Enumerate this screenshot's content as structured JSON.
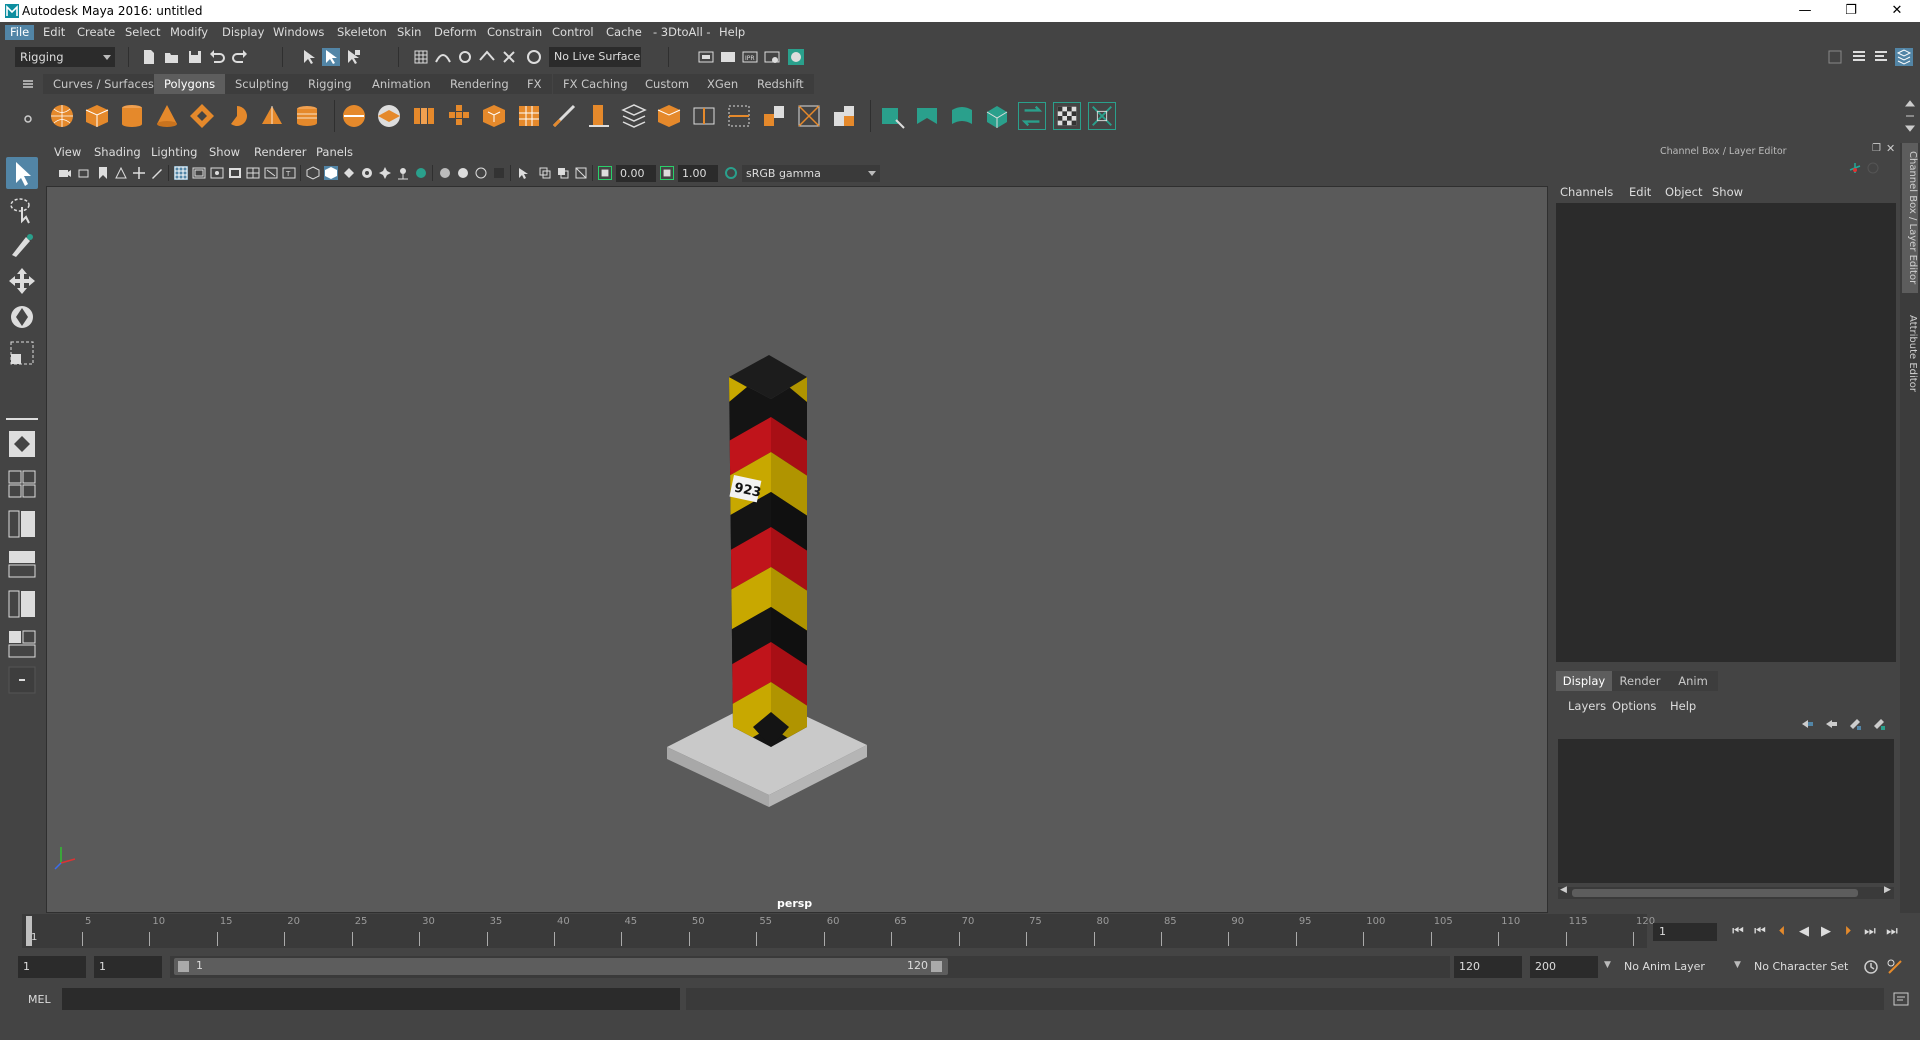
{
  "window": {
    "title": "Autodesk Maya 2016: untitled",
    "minimize": "—",
    "maximize": "❐",
    "close": "✕"
  },
  "menubar": [
    "File",
    "Edit",
    "Create",
    "Select",
    "Modify",
    "Display",
    "Windows",
    "Skeleton",
    "Skin",
    "Deform",
    "Constrain",
    "Control",
    "Cache",
    "- 3DtoAll -",
    "Help"
  ],
  "status": {
    "mode": "Rigging",
    "live_surface": "No Live Surface"
  },
  "shelf_tabs": [
    "Curves / Surfaces",
    "Polygons",
    "Sculpting",
    "Rigging",
    "Animation",
    "Rendering",
    "FX",
    "FX Caching",
    "Custom",
    "XGen",
    "Redshift"
  ],
  "shelf_active_tab": "Polygons",
  "viewport": {
    "menu": [
      "View",
      "Shading",
      "Lighting",
      "Show",
      "Renderer",
      "Panels"
    ],
    "exposure": "0.00",
    "gamma": "1.00",
    "color_space": "sRGB gamma",
    "camera_label": "persp",
    "marker_text": "923"
  },
  "channel_box": {
    "title": "Channel Box / Layer Editor",
    "menu": [
      "Channels",
      "Edit",
      "Object",
      "Show"
    ]
  },
  "layer_editor": {
    "tabs": [
      "Display",
      "Render",
      "Anim"
    ],
    "menu": [
      "Layers",
      "Options",
      "Help"
    ]
  },
  "side_tabs": [
    "Channel Box / Layer Editor",
    "Attribute Editor"
  ],
  "timeline": {
    "labels": [
      "1",
      "5",
      "10",
      "15",
      "20",
      "25",
      "30",
      "35",
      "40",
      "45",
      "50",
      "55",
      "60",
      "65",
      "70",
      "75",
      "80",
      "85",
      "90",
      "95",
      "100",
      "105",
      "110",
      "115",
      "120"
    ],
    "current_frame": "1"
  },
  "range": {
    "start": "1",
    "playback_start": "1",
    "slider_start": "1",
    "slider_end": "120",
    "playback_end": "120",
    "end": "200",
    "anim_layer": "No Anim Layer",
    "character_set": "No Character Set"
  },
  "command_line": {
    "label": "MEL"
  },
  "colors": {
    "accent": "#5285a6",
    "panel_bg": "#444444",
    "field_bg": "#2b2b2b",
    "viewport_bg": "#5a5a5a",
    "pole_red": "#c0141b",
    "pole_yellow": "#c8a800",
    "pole_black": "#141414"
  }
}
